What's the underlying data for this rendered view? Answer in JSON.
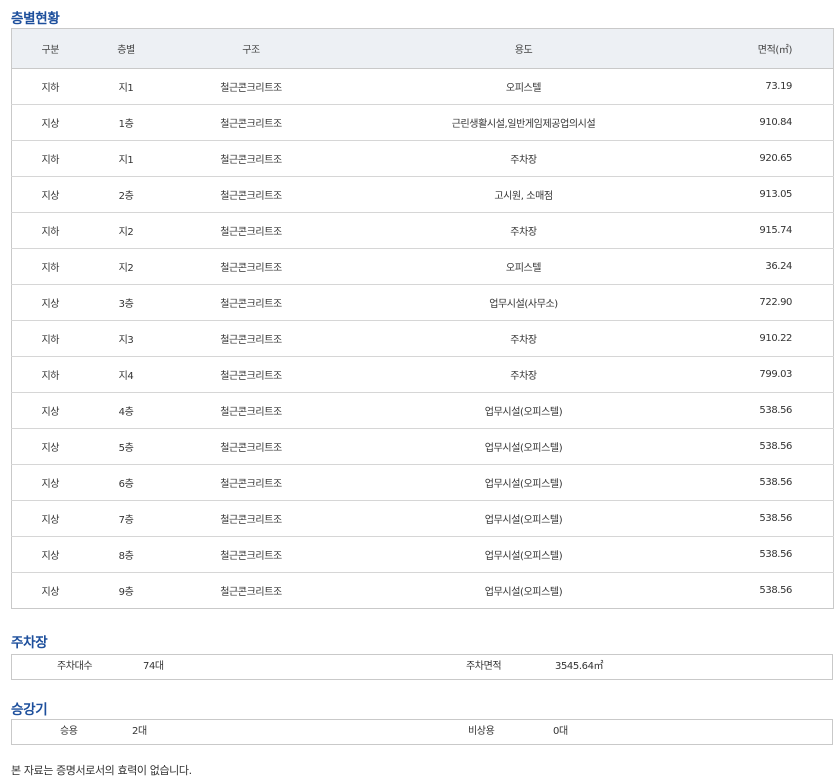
{
  "floor_section": {
    "title": "층별현황",
    "headers": [
      "구분",
      "층별",
      "구조",
      "용도",
      "면적(㎡)"
    ],
    "rows": [
      [
        "지하",
        "지1",
        "철근콘크리트조",
        "오피스텔",
        "73.19"
      ],
      [
        "지상",
        "1층",
        "철근콘크리트조",
        "근린생활시설,일반게임제공업의시설",
        "910.84"
      ],
      [
        "지하",
        "지1",
        "철근콘크리트조",
        "주차장",
        "920.65"
      ],
      [
        "지상",
        "2층",
        "철근콘크리트조",
        "고시원, 소매점",
        "913.05"
      ],
      [
        "지하",
        "지2",
        "철근콘크리트조",
        "주차장",
        "915.74"
      ],
      [
        "지하",
        "지2",
        "철근콘크리트조",
        "오피스텔",
        "36.24"
      ],
      [
        "지상",
        "3층",
        "철근콘크리트조",
        "업무시설(사무소)",
        "722.90"
      ],
      [
        "지하",
        "지3",
        "철근콘크리트조",
        "주차장",
        "910.22"
      ],
      [
        "지하",
        "지4",
        "철근콘크리트조",
        "주차장",
        "799.03"
      ],
      [
        "지상",
        "4층",
        "철근콘크리트조",
        "업무시설(오피스텔)",
        "538.56"
      ],
      [
        "지상",
        "5층",
        "철근콘크리트조",
        "업무시설(오피스텔)",
        "538.56"
      ],
      [
        "지상",
        "6층",
        "철근콘크리트조",
        "업무시설(오피스텔)",
        "538.56"
      ],
      [
        "지상",
        "7층",
        "철근콘크리트조",
        "업무시설(오피스텔)",
        "538.56"
      ],
      [
        "지상",
        "8층",
        "철근콘크리트조",
        "업무시설(오피스텔)",
        "538.56"
      ],
      [
        "지상",
        "9층",
        "철근콘크리트조",
        "업무시설(오피스텔)",
        "538.56"
      ]
    ]
  },
  "parking": {
    "title": "주차장",
    "count_label": "주차대수",
    "count_value": "74대",
    "area_label": "주차면적",
    "area_value": "3545.64㎡"
  },
  "elevator": {
    "title": "승강기",
    "passenger_label": "승용",
    "passenger_value": "2대",
    "emergency_label": "비상용",
    "emergency_value": "0대"
  },
  "notice": "본 자료는 증명서로서의 효력이 없습니다."
}
